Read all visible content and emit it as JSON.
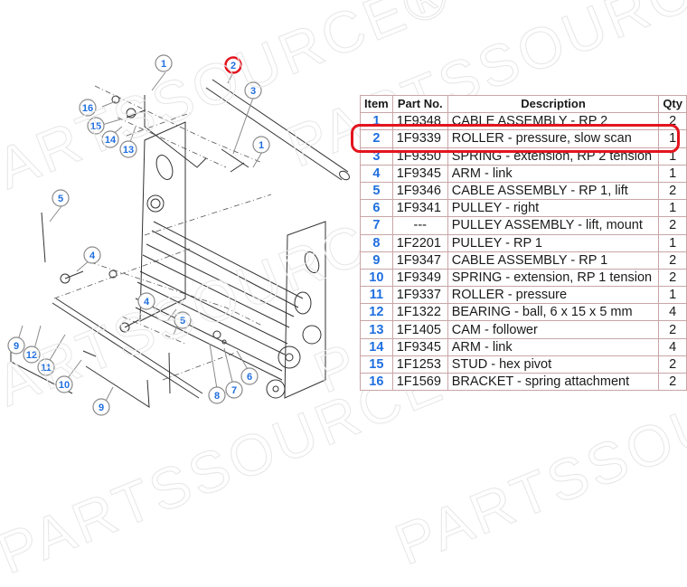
{
  "watermark": "PARTSSOURCE®",
  "table": {
    "headers": {
      "item": "Item",
      "part_no": "Part No.",
      "description": "Description",
      "qty": "Qty"
    },
    "rows": [
      {
        "item": "1",
        "part_no": "1F9348",
        "description": "CABLE ASSEMBLY - RP 2",
        "qty": "2"
      },
      {
        "item": "2",
        "part_no": "1F9339",
        "description": "ROLLER - pressure, slow scan",
        "qty": "1"
      },
      {
        "item": "3",
        "part_no": "1F9350",
        "description": "SPRING - extension, RP 2 tension",
        "qty": "1"
      },
      {
        "item": "4",
        "part_no": "1F9345",
        "description": "ARM - link",
        "qty": "1"
      },
      {
        "item": "5",
        "part_no": "1F9346",
        "description": "CABLE ASSEMBLY - RP 1, lift",
        "qty": "2"
      },
      {
        "item": "6",
        "part_no": "1F9341",
        "description": "PULLEY - right",
        "qty": "1"
      },
      {
        "item": "7",
        "part_no": "---",
        "description": "PULLEY ASSEMBLY - lift, mount",
        "qty": "2"
      },
      {
        "item": "8",
        "part_no": "1F2201",
        "description": "PULLEY - RP 1",
        "qty": "1"
      },
      {
        "item": "9",
        "part_no": "1F9347",
        "description": "CABLE ASSEMBLY - RP 1",
        "qty": "2"
      },
      {
        "item": "10",
        "part_no": "1F9349",
        "description": "SPRING - extension, RP 1 tension",
        "qty": "2"
      },
      {
        "item": "11",
        "part_no": "1F9337",
        "description": "ROLLER - pressure",
        "qty": "1"
      },
      {
        "item": "12",
        "part_no": "1F1322",
        "description": "BEARING - ball, 6 x 15 x 5 mm",
        "qty": "4"
      },
      {
        "item": "13",
        "part_no": "1F1405",
        "description": "CAM - follower",
        "qty": "2"
      },
      {
        "item": "14",
        "part_no": "1F9345",
        "description": "ARM - link",
        "qty": "4"
      },
      {
        "item": "15",
        "part_no": "1F1253",
        "description": "STUD - hex pivot",
        "qty": "2"
      },
      {
        "item": "16",
        "part_no": "1F1569",
        "description": "BRACKET - spring attachment",
        "qty": "2"
      }
    ],
    "highlighted_item": "2"
  },
  "callouts": [
    {
      "label": "1"
    },
    {
      "label": "2"
    },
    {
      "label": "3"
    },
    {
      "label": "1"
    },
    {
      "label": "16"
    },
    {
      "label": "15"
    },
    {
      "label": "14"
    },
    {
      "label": "13"
    },
    {
      "label": "5"
    },
    {
      "label": "4"
    },
    {
      "label": "4"
    },
    {
      "label": "5"
    },
    {
      "label": "9"
    },
    {
      "label": "12"
    },
    {
      "label": "11"
    },
    {
      "label": "10"
    },
    {
      "label": "9"
    },
    {
      "label": "8"
    },
    {
      "label": "7"
    },
    {
      "label": "6"
    }
  ],
  "colors": {
    "callout_text": "#1f6fe0",
    "highlight": "#e3141e",
    "table_border": "#c9a5a7"
  }
}
